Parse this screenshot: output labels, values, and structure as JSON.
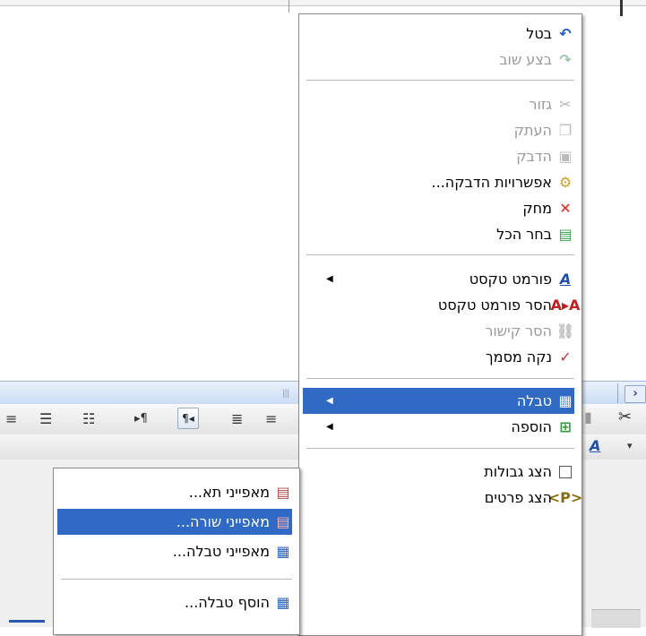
{
  "context_menu": {
    "items": [
      {
        "label": "בטל",
        "icon": "undo-icon",
        "disabled": false
      },
      {
        "label": "בצע שוב",
        "icon": "redo-icon",
        "disabled": true
      },
      {
        "label": "גזור",
        "icon": "scissors-icon",
        "disabled": true
      },
      {
        "label": "העתק",
        "icon": "copy-icon",
        "disabled": true
      },
      {
        "label": "הדבק",
        "icon": "paste-icon",
        "disabled": true
      },
      {
        "label": "אפשרויות הדבקה...",
        "icon": "paste-options-icon",
        "disabled": false
      },
      {
        "label": "מחק",
        "icon": "delete-icon",
        "disabled": false
      },
      {
        "label": "בחר הכל",
        "icon": "select-all-icon",
        "disabled": false
      },
      {
        "label": "פורמט טקסט",
        "icon": "text-format-icon",
        "disabled": false,
        "submenu": true
      },
      {
        "label": "הסר פורמט טקסט",
        "icon": "remove-format-icon",
        "disabled": false
      },
      {
        "label": "הסר קישור",
        "icon": "unlink-icon",
        "disabled": true
      },
      {
        "label": "נקה מסמך",
        "icon": "clean-document-icon",
        "disabled": false
      },
      {
        "label": "טבלה",
        "icon": "table-icon",
        "disabled": false,
        "submenu": true,
        "selected": true
      },
      {
        "label": "הוספה",
        "icon": "insert-icon",
        "disabled": false,
        "submenu": true
      },
      {
        "label": "הצג גבולות",
        "icon": "show-borders-icon",
        "disabled": false
      },
      {
        "label": "הצג פרטים",
        "icon": "show-details-icon",
        "disabled": false
      }
    ]
  },
  "table_submenu": {
    "items": [
      {
        "label": "מאפייני תא...",
        "icon": "cell-properties-icon"
      },
      {
        "label": "מאפייני שורה...",
        "icon": "row-properties-icon",
        "selected": true
      },
      {
        "label": "מאפייני טבלה...",
        "icon": "table-properties-icon"
      },
      {
        "label": "הוסף טבלה...",
        "icon": "insert-table-icon"
      }
    ]
  },
  "colors": {
    "selection": "#316ac5",
    "disabled_text": "#9a9a9a"
  }
}
